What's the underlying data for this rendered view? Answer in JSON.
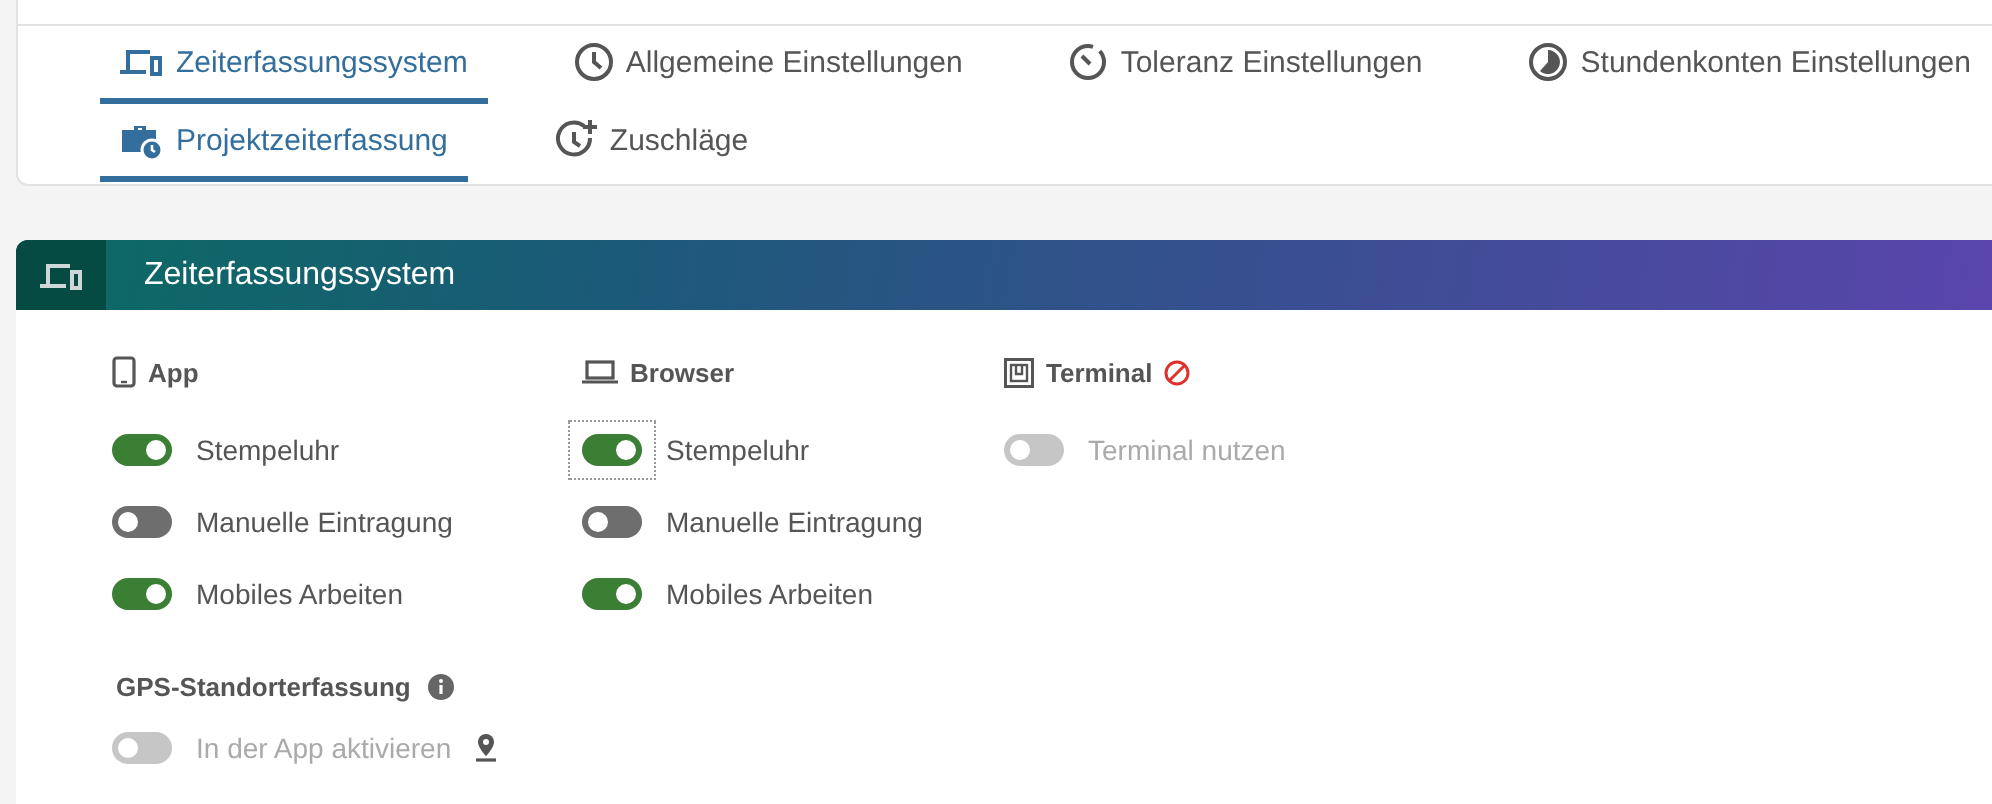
{
  "tabs": [
    [
      {
        "label": "Zeiterfassungssystem",
        "kind": "devices",
        "selected": true
      },
      {
        "label": "Allgemeine Einstellungen",
        "kind": "clock",
        "selected": false
      },
      {
        "label": "Toleranz Einstellungen",
        "kind": "timer",
        "selected": false
      },
      {
        "label": "Stundenkonten Einstellungen",
        "kind": "pie",
        "selected": false
      }
    ],
    [
      {
        "label": "Projektzeiterfassung",
        "kind": "briefcase",
        "selected": true
      },
      {
        "label": "Zuschläge",
        "kind": "clockplus",
        "selected": false
      }
    ]
  ],
  "panel": {
    "title": "Zeiterfassungssystem",
    "columns": [
      {
        "heading": "App",
        "kind": "phone",
        "blocked": false,
        "items": [
          {
            "label": "Stempeluhr",
            "on": true,
            "disabled": false,
            "focused": false
          },
          {
            "label": "Manuelle Eintragung",
            "on": false,
            "disabled": false,
            "focused": false
          },
          {
            "label": "Mobiles Arbeiten",
            "on": true,
            "disabled": false,
            "focused": false
          }
        ]
      },
      {
        "heading": "Browser",
        "kind": "laptop",
        "blocked": false,
        "items": [
          {
            "label": "Stempeluhr",
            "on": true,
            "disabled": false,
            "focused": true
          },
          {
            "label": "Manuelle Eintragung",
            "on": false,
            "disabled": false,
            "focused": false
          },
          {
            "label": "Mobiles Arbeiten",
            "on": true,
            "disabled": false,
            "focused": false
          }
        ]
      },
      {
        "heading": "Terminal",
        "kind": "terminal",
        "blocked": true,
        "items": [
          {
            "label": "Terminal nutzen",
            "on": false,
            "disabled": true,
            "focused": false
          }
        ]
      }
    ],
    "gps": {
      "heading": "GPS-Standorterfassung",
      "item": {
        "label": "In der App aktivieren",
        "on": false,
        "disabled": true,
        "focused": false
      }
    }
  }
}
